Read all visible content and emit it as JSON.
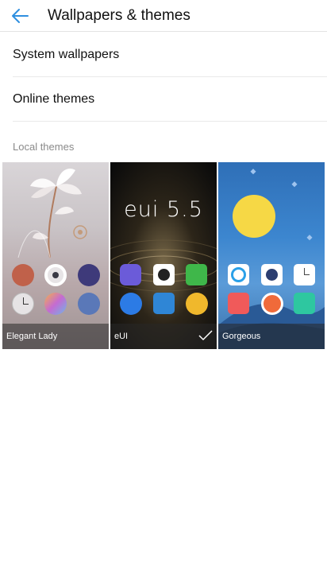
{
  "header": {
    "title": "Wallpapers & themes"
  },
  "menu": {
    "system_wallpapers": "System wallpapers",
    "online_themes": "Online themes"
  },
  "local_themes": {
    "section_title": "Local themes",
    "themes": [
      {
        "name": "Elegant Lady",
        "selected": false
      },
      {
        "name": "eUI",
        "selected": true
      },
      {
        "name": "Gorgeous",
        "selected": false
      }
    ],
    "eui_brand_text": "eui 5.5"
  },
  "colors": {
    "accent": "#2e8fe0",
    "sun": "#f6d845"
  }
}
